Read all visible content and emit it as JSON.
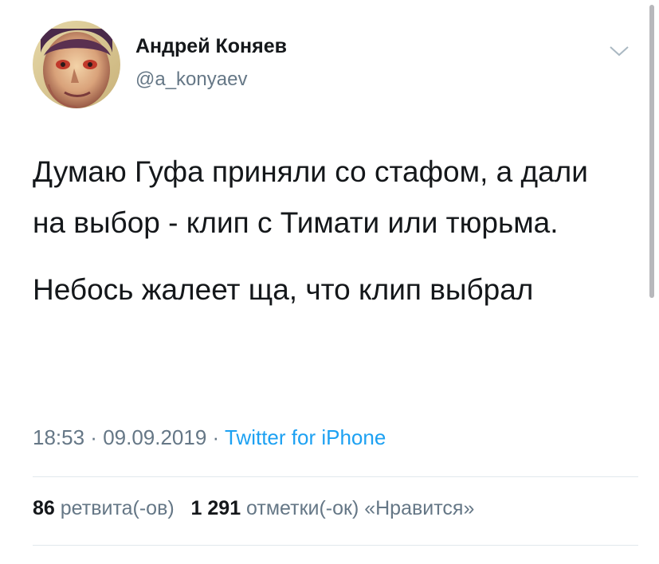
{
  "author": {
    "display_name": "Андрей Коняев",
    "handle": "@a_konyaev"
  },
  "tweet": {
    "paragraph_1": "Думаю Гуфа приняли со стафом, а дали на выбор - клип с Тимати или тюрьма.",
    "paragraph_2": "Небось жалеет ща, что клип выбрал"
  },
  "meta": {
    "time": "18:53",
    "separator_1": " · ",
    "date": "09.09.2019",
    "separator_2": " · ",
    "source": "Twitter for iPhone"
  },
  "stats": {
    "retweets_count": "86",
    "retweets_label": "ретвита(-ов)",
    "likes_count": "1 291",
    "likes_label": "отметки(-ок) «Нравится»"
  },
  "colors": {
    "text_primary": "#14171a",
    "text_secondary": "#657786",
    "link": "#1da1f2",
    "divider": "#e1e8ed"
  },
  "icons": {
    "caret": "chevron-down-icon"
  }
}
